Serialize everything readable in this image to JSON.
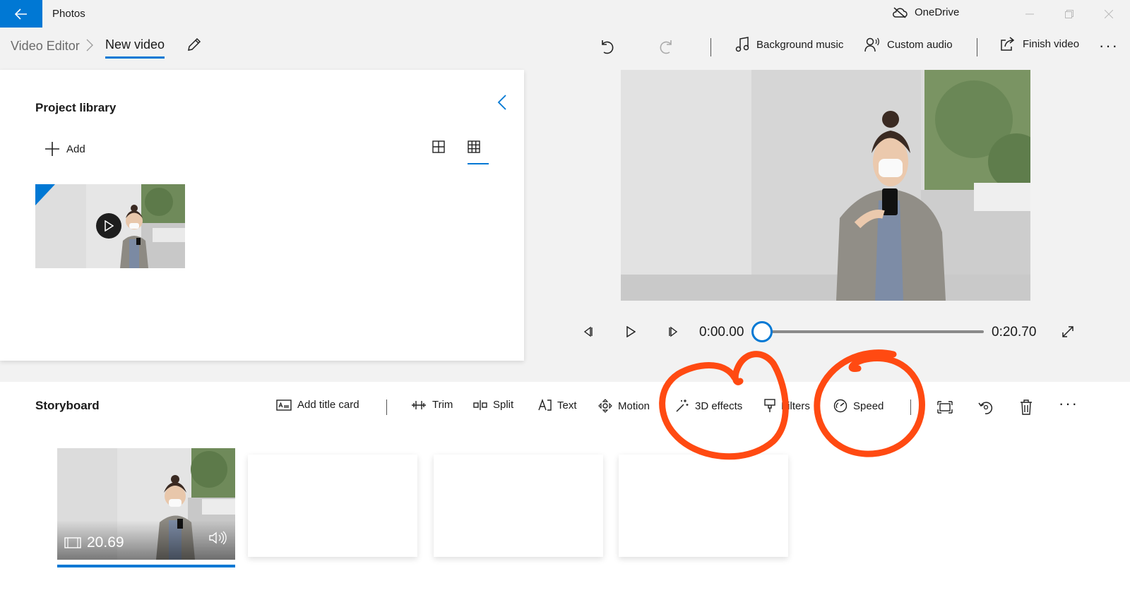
{
  "titlebar": {
    "app_name": "Photos",
    "onedrive_label": "OneDrive"
  },
  "header": {
    "breadcrumb_root": "Video Editor",
    "breadcrumb_current": "New video",
    "toolbar": {
      "background_music": "Background music",
      "custom_audio": "Custom audio",
      "finish_video": "Finish video",
      "more": "···"
    }
  },
  "library": {
    "title": "Project library",
    "add_label": "Add"
  },
  "player": {
    "current_time": "0:00.00",
    "total_time": "0:20.70",
    "progress": 0
  },
  "storyboard": {
    "title": "Storyboard",
    "tools": {
      "add_title_card": "Add title card",
      "trim": "Trim",
      "split": "Split",
      "text": "Text",
      "motion": "Motion",
      "effects_3d": "3D effects",
      "filters": "Filters",
      "speed": "Speed",
      "more": "···"
    },
    "clip": {
      "duration": "20.69"
    }
  },
  "colors": {
    "accent": "#0078d4",
    "annotation": "#ff4a12"
  }
}
